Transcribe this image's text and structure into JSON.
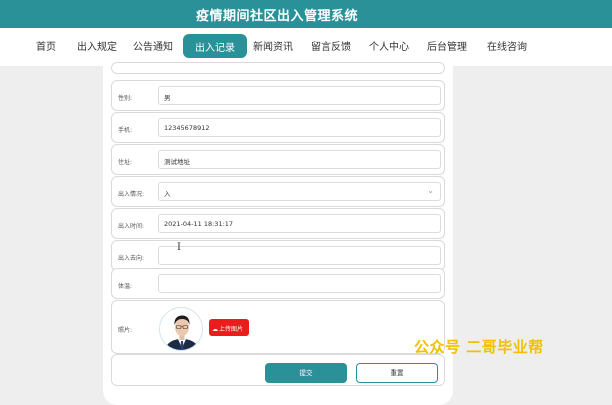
{
  "header": {
    "title": "疫情期间社区出入管理系统"
  },
  "nav": {
    "items": [
      "首页",
      "出入规定",
      "公告通知",
      "出入记录",
      "新闻资讯",
      "留言反馈",
      "个人中心",
      "后台管理",
      "在线咨询"
    ],
    "active_index": 3
  },
  "form": {
    "gender": {
      "label": "性别:",
      "value": "男"
    },
    "phone": {
      "label": "手机:",
      "value": "12345678912"
    },
    "address": {
      "label": "住址:",
      "value": "测试地址"
    },
    "direction": {
      "label": "出入情况:",
      "value": "入"
    },
    "time": {
      "label": "出入时间:",
      "value": "2021-04-11 18:31:17"
    },
    "destination": {
      "label": "出入去向:",
      "value": ""
    },
    "temperature": {
      "label": "体温:",
      "value": ""
    },
    "photo": {
      "label": "照片:",
      "upload_label": "上传图片"
    },
    "submit_label": "提交",
    "reset_label": "重置"
  },
  "watermark": "公众号 二哥毕业帮",
  "colors": {
    "primary": "#2a9199",
    "upload": "#ea1d1d",
    "watermark": "#f2c000"
  },
  "icons": {
    "caret": "chevron-down-icon",
    "upload": "cloud-upload-icon"
  }
}
